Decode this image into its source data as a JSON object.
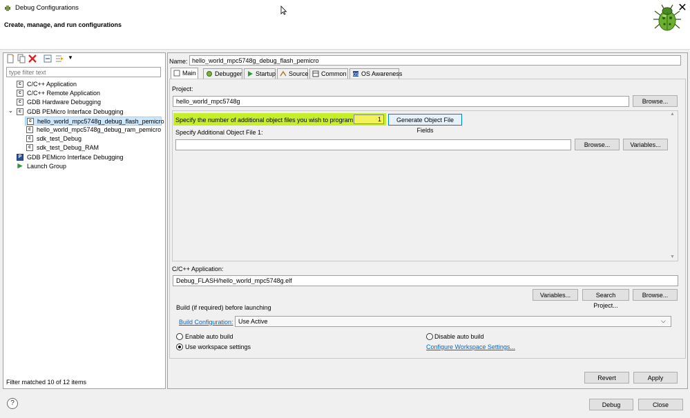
{
  "window": {
    "title": "Debug Configurations",
    "close_glyph": "✕"
  },
  "banner": {
    "title": "Create, manage, and run configurations",
    "icon": "bug-icon"
  },
  "left": {
    "filter_placeholder": "type filter text",
    "toolbar_icons": [
      "new-config-icon",
      "duplicate-icon",
      "delete-icon",
      "collapse-all-icon",
      "filter-icon"
    ],
    "tree": [
      {
        "label": "C/C++ Application",
        "indent": 0,
        "icon": "c-icon"
      },
      {
        "label": "C/C++ Remote Application",
        "indent": 0,
        "icon": "c-icon"
      },
      {
        "label": "GDB Hardware Debugging",
        "indent": 0,
        "icon": "c-icon"
      },
      {
        "label": "GDB PEMicro Interface Debugging",
        "indent": 0,
        "icon": "c-icon"
      },
      {
        "label": "hello_world_mpc5748g_debug_flash_pemicro",
        "indent": 1,
        "icon": "c-icon"
      },
      {
        "label": "hello_world_mpc5748g_debug_ram_pemicro",
        "indent": 1,
        "icon": "c-icon"
      },
      {
        "label": "sdk_test_Debug",
        "indent": 1,
        "icon": "c-icon"
      },
      {
        "label": "sdk_test_Debug_RAM",
        "indent": 1,
        "icon": "c-icon"
      },
      {
        "label": "GDB PEMicro Interface Debugging",
        "indent": 0,
        "icon": "pemicro-icon"
      },
      {
        "label": "Launch Group",
        "indent": 0,
        "icon": "launch-icon"
      }
    ],
    "filter_status": "Filter matched 10 of 12 items"
  },
  "right": {
    "name_label": "Name:",
    "name_value": "hello_world_mpc5748g_debug_flash_pemicro",
    "tabs": [
      "Main",
      "Debugger",
      "Startup",
      "Source",
      "Common",
      "OS Awareness"
    ],
    "project_label": "Project:",
    "project_value": "hello_world_mpc5748g",
    "browse_label": "Browse...",
    "variables_label": "Variables...",
    "search_project_label": "Search Project...",
    "objfiles_prompt": "Specify the number of additional object files you wish to program:",
    "objfiles_count": "1",
    "generate_label": "Generate Object File Fields",
    "objfile1_label": "Specify Additional Object File 1:",
    "objfile1_value": "",
    "app_label": "C/C++ Application:",
    "app_value": "Debug_FLASH/hello_world_mpc5748g.elf",
    "build_group_label": "Build (if required) before launching",
    "build_config_link": "Build Configuration:",
    "build_config_value": "Use Active",
    "enable_auto_build": "Enable auto build",
    "disable_auto_build": "Disable auto build",
    "use_workspace": "Use workspace settings",
    "configure_workspace_link": "Configure Workspace Settings...",
    "revert_label": "Revert",
    "apply_label": "Apply"
  },
  "footer": {
    "help_glyph": "?",
    "debug_label": "Debug",
    "close_label": "Close"
  }
}
